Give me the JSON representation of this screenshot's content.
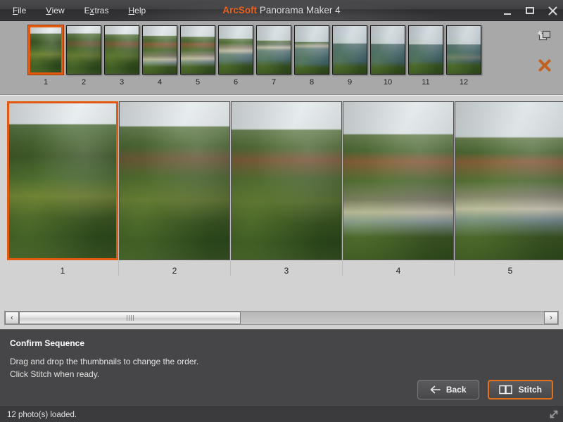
{
  "window": {
    "title_brand": "ArcSoft",
    "title_rest": " Panorama Maker 4",
    "controls": {
      "minimize": "minimize-icon",
      "maximize": "maximize-icon",
      "close": "close-icon"
    }
  },
  "menu": {
    "items": [
      {
        "label": "File",
        "accel_index": 0
      },
      {
        "label": "View",
        "accel_index": 0
      },
      {
        "label": "Extras",
        "accel_index": 1
      },
      {
        "label": "Help",
        "accel_index": 0
      }
    ]
  },
  "filmstrip": {
    "selected_index": 0,
    "thumbnails": [
      {
        "label": "1",
        "scene": "bridge-close"
      },
      {
        "label": "2",
        "scene": "bridge-mid"
      },
      {
        "label": "3",
        "scene": "bridge-far"
      },
      {
        "label": "4",
        "scene": "cliff-beach"
      },
      {
        "label": "5",
        "scene": "cliff-ocean"
      },
      {
        "label": "6",
        "scene": "coast-ocean"
      },
      {
        "label": "7",
        "scene": "coast-wide"
      },
      {
        "label": "8",
        "scene": "ocean-headland"
      },
      {
        "label": "9",
        "scene": "ocean-open"
      },
      {
        "label": "10",
        "scene": "ocean-open2"
      },
      {
        "label": "11",
        "scene": "ocean-rocks"
      },
      {
        "label": "12",
        "scene": "ocean-cliff"
      }
    ],
    "tools": [
      {
        "name": "add-photos-icon",
        "title": "Add Photos"
      },
      {
        "name": "delete-photo-icon",
        "title": "Delete Photo"
      }
    ]
  },
  "preview": {
    "selected_index": 0,
    "items": [
      {
        "label": "1",
        "scene": "bridge-close"
      },
      {
        "label": "2",
        "scene": "bridge-mid"
      },
      {
        "label": "3",
        "scene": "bridge-far"
      },
      {
        "label": "4",
        "scene": "cliff-beach"
      },
      {
        "label": "5",
        "scene": "cliff-ocean"
      }
    ]
  },
  "scrollbar": {
    "left_arrow": "‹",
    "right_arrow": "›",
    "thumb_position_pct": 0,
    "thumb_width_pct": 42
  },
  "instructions": {
    "title": "Confirm Sequence",
    "line1": "Drag and drop the thumbnails to change the order.",
    "line2": "Click Stitch when ready."
  },
  "actions": {
    "back_label": "Back",
    "back_icon": "arrow-left-icon",
    "stitch_label": "Stitch",
    "stitch_icon": "stitch-panels-icon"
  },
  "statusbar": {
    "text": "12 photo(s) loaded.",
    "resize_grip": "resize-grip-icon"
  },
  "colors": {
    "accent_orange": "#e2701c",
    "selection_orange": "#e25a10",
    "titlebar_dark": "#3f3f41",
    "panel_gray": "#d2d2d2",
    "filmstrip_gray": "#a8a8a8",
    "instruction_gray": "#464648"
  }
}
